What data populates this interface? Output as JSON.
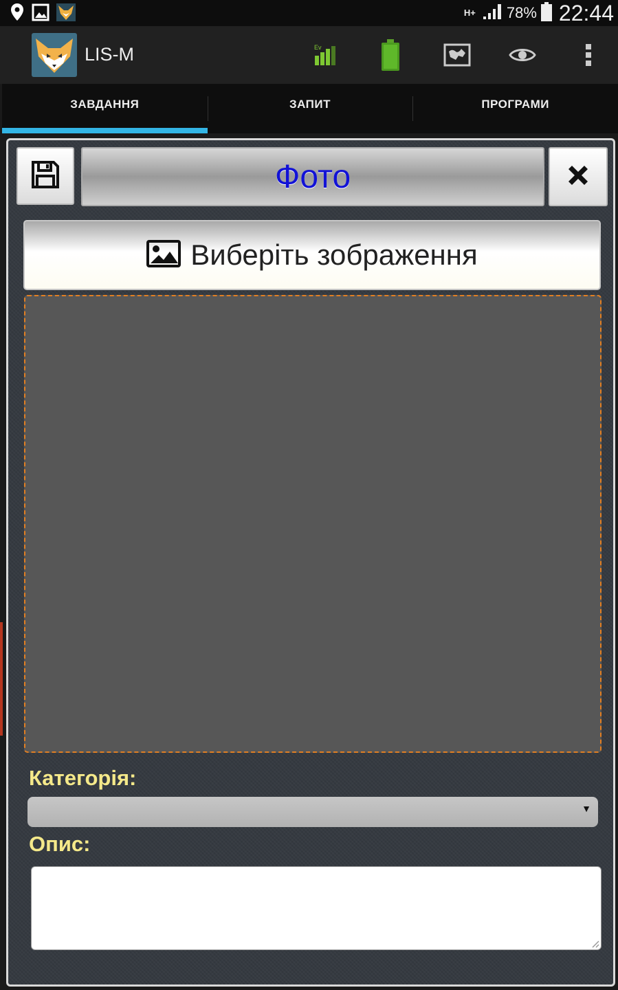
{
  "status_bar": {
    "left_icons": [
      "location-icon",
      "image-icon",
      "fox-notification-icon"
    ],
    "network_type": "H+",
    "battery_percent": "78%",
    "time": "22:44"
  },
  "action_bar": {
    "app_title": "LIS-M",
    "icons": [
      "signal-ev-icon",
      "battery-icon",
      "map-icon",
      "eye-icon",
      "overflow-menu-icon"
    ]
  },
  "tabs": [
    {
      "label": "ЗАВДАННЯ",
      "active": true
    },
    {
      "label": "ЗАПИТ",
      "active": false
    },
    {
      "label": "ПРОГРАМИ",
      "active": false
    }
  ],
  "dialog": {
    "title": "Фото",
    "choose_image_label": "Виберіть зображення",
    "category_label": "Категорія:",
    "category_value": "",
    "description_label": "Опис:",
    "description_value": ""
  },
  "colors": {
    "accent": "#33b5e5",
    "title_text": "#1212d6",
    "label_text": "#f5e98a",
    "dashed_border": "#e27f22"
  }
}
